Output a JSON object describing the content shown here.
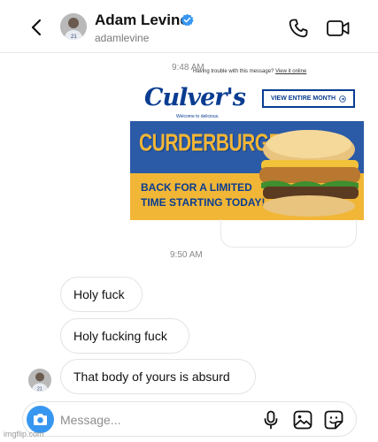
{
  "header": {
    "contact_name": "Adam Levine",
    "contact_handle": "adamlevine",
    "verified": true,
    "icons": [
      "back-arrow-icon",
      "verified-badge-icon",
      "phone-icon",
      "video-camera-icon"
    ]
  },
  "thread": {
    "timestamp_top": "9:48 AM",
    "trouble_text": "Having trouble with this message?",
    "trouble_link": "View it online",
    "ad": {
      "brand": "Culver's",
      "tagline": "Welcome to delicious.",
      "cta": "VIEW ENTIRE MONTH",
      "headline": "CURDERBURGER",
      "subline_1": "BACK FOR A LIMITED",
      "subline_2": "TIME STARTING TODAY!"
    },
    "timestamp_mid": "9:50 AM",
    "messages": [
      {
        "text": "Holy fuck"
      },
      {
        "text": "Holy fucking fuck"
      },
      {
        "text": "That body of yours is absurd"
      }
    ]
  },
  "composer": {
    "placeholder": "Message...",
    "icons": [
      "camera-icon",
      "microphone-icon",
      "gallery-icon",
      "sticker-icon"
    ]
  },
  "watermark": "imgflip.com",
  "colors": {
    "verified_blue": "#3797f0",
    "camera_blue": "#3797f0",
    "brand_blue": "#0a3d91",
    "ad_blue_band": "#2b5aa6",
    "ad_gold": "#f2b636"
  }
}
